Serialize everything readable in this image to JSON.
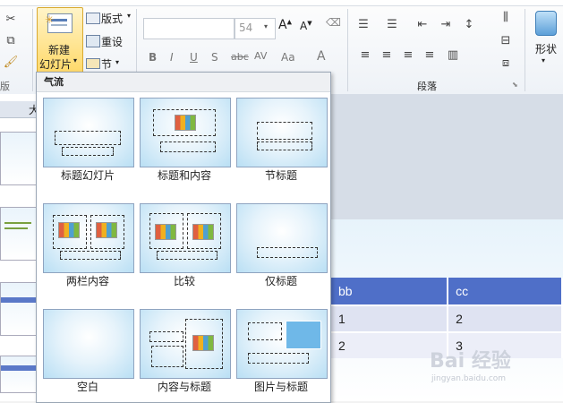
{
  "ribbon": {
    "new_slide_label_1": "新建",
    "new_slide_label_2": "幻灯片",
    "layout_label": "版式",
    "reset_label": "重设",
    "section_label": "节",
    "font_size": "54",
    "paragraph_group": "段落",
    "shapes_label": "形状",
    "slides_group_stub": "版",
    "font_buttons": [
      "B",
      "I",
      "U",
      "S",
      "abc",
      "AV",
      "Aa",
      "A"
    ],
    "icons": [
      "scissors-icon",
      "copy-icon",
      "format-painter-icon",
      "new-slide-icon",
      "layout-icon",
      "reset-icon",
      "section-icon"
    ]
  },
  "left_tab_stub": "大",
  "gallery": {
    "title": "气流",
    "layouts": [
      {
        "label": "标题幻灯片"
      },
      {
        "label": "标题和内容"
      },
      {
        "label": "节标题"
      },
      {
        "label": "两栏内容"
      },
      {
        "label": "比较"
      },
      {
        "label": "仅标题"
      },
      {
        "label": "空白"
      },
      {
        "label": "内容与标题"
      },
      {
        "label": "图片与标题"
      }
    ]
  },
  "table": {
    "headers": [
      "bb",
      "cc"
    ],
    "rows": [
      [
        "1",
        "2"
      ],
      [
        "2",
        "3"
      ]
    ]
  },
  "watermark": {
    "text": "Bai 经验",
    "sub": "jingyan.baidu.com"
  }
}
